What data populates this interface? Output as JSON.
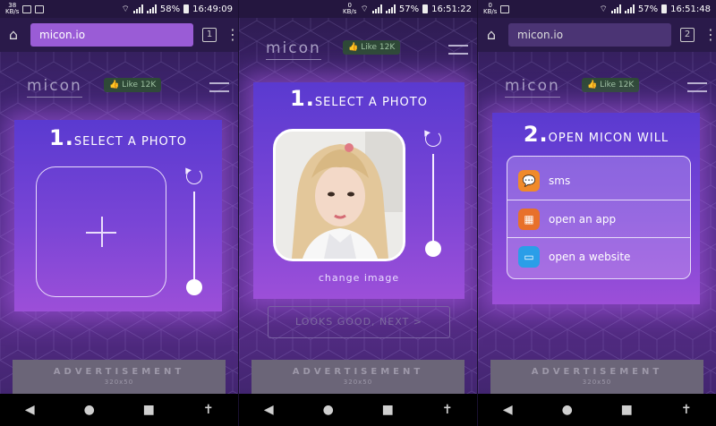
{
  "panels": [
    {
      "status": {
        "kbs_top": "38",
        "kbs_bottom": "KB/s",
        "battery": "58%",
        "time": "16:49:09"
      },
      "address": {
        "url": "micon.io",
        "tabs_count": "1"
      },
      "header": {
        "logo": "micon",
        "like": "Like 12K"
      },
      "card": {
        "step_num": "1.",
        "step_text": "SELECT A PHOTO"
      },
      "ad": {
        "label": "ADVERTISEMENT",
        "size": "320x50"
      }
    },
    {
      "status": {
        "kbs_top": "0",
        "kbs_bottom": "KB/s",
        "battery": "57%",
        "time": "16:51:22"
      },
      "header": {
        "logo": "micon",
        "like": "Like 12K"
      },
      "card": {
        "step_num": "1.",
        "step_text": "SELECT A PHOTO",
        "change_image": "change image"
      },
      "button": {
        "label": "LOOKS GOOD, NEXT >"
      },
      "ad": {
        "label": "ADVERTISEMENT",
        "size": "320x50"
      }
    },
    {
      "status": {
        "kbs_top": "0",
        "kbs_bottom": "KB/s",
        "battery": "57%",
        "time": "16:51:48"
      },
      "address": {
        "url": "micon.io",
        "tabs_count": "2"
      },
      "header": {
        "logo": "micon",
        "like": "Like 12K"
      },
      "card": {
        "step_num": "2.",
        "step_text": "OPEN MICON WILL"
      },
      "menu": [
        {
          "label": "sms",
          "icon": "sms-icon",
          "color": "#f08a2a"
        },
        {
          "label": "open an app",
          "icon": "app-grid-icon",
          "color": "#e8702a"
        },
        {
          "label": "open a website",
          "icon": "website-icon",
          "color": "#2a9ee8"
        }
      ],
      "ad": {
        "label": "ADVERTISEMENT",
        "size": "320x50"
      }
    }
  ],
  "colors": {
    "card_top": "#5a3ad0",
    "card_bottom": "#9c4fd8",
    "url_active": "#9a5cd6"
  }
}
